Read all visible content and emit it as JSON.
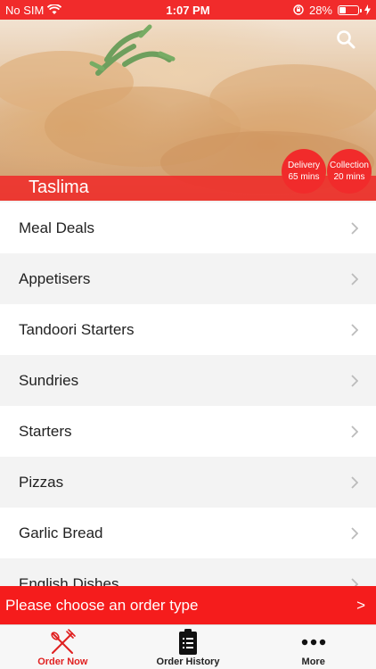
{
  "status": {
    "carrier": "No SIM",
    "time": "1:07 PM",
    "battery": "28%"
  },
  "restaurant": {
    "name": "Taslima",
    "delivery": {
      "label": "Delivery",
      "time": "65 mins"
    },
    "collection": {
      "label": "Collection",
      "time": "20 mins"
    }
  },
  "menu": {
    "items": [
      {
        "label": "Meal Deals"
      },
      {
        "label": "Appetisers"
      },
      {
        "label": "Tandoori Starters"
      },
      {
        "label": "Sundries"
      },
      {
        "label": "Starters"
      },
      {
        "label": "Pizzas"
      },
      {
        "label": "Garlic Bread"
      },
      {
        "label": "English Dishes"
      }
    ]
  },
  "order_bar": {
    "label": "Please choose an order type",
    "arrow": ">"
  },
  "tabs": [
    {
      "label": "Order Now",
      "icon": "fork-knife-icon",
      "active": true
    },
    {
      "label": "Order History",
      "icon": "clipboard-icon",
      "active": false
    },
    {
      "label": "More",
      "icon": "more-dots-icon",
      "active": false
    }
  ],
  "colors": {
    "accent": "#f12b2b",
    "order_bar": "#f51c1c",
    "tab_active": "#e02020"
  }
}
